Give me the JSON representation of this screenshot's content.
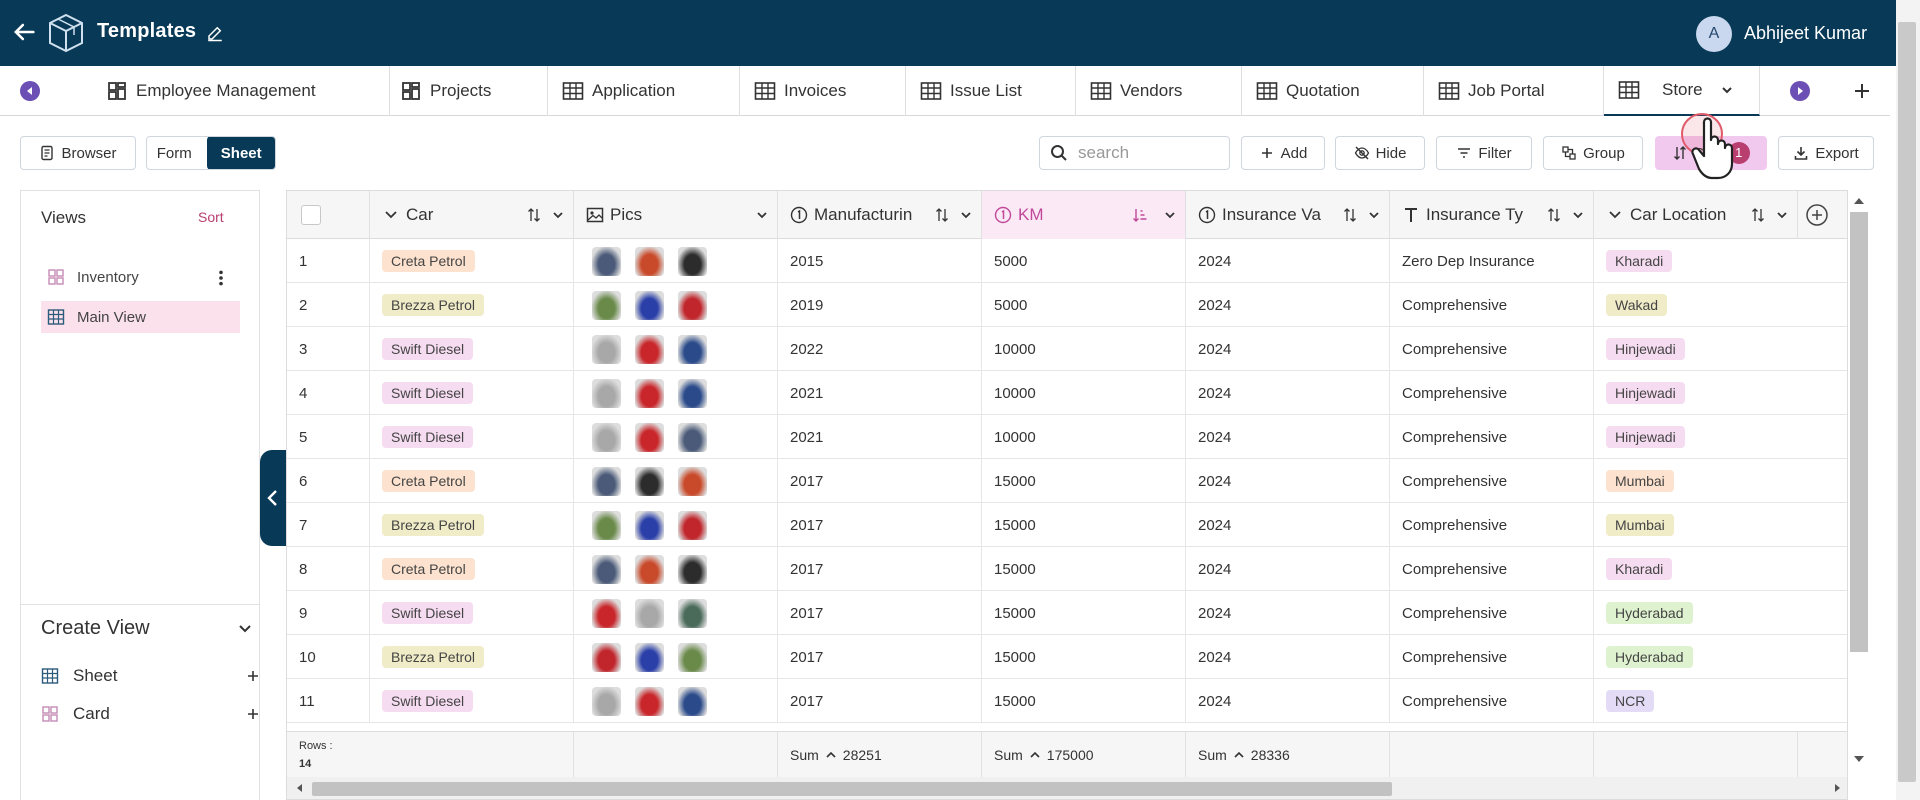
{
  "topbar": {
    "title": "Templates",
    "user_initial": "A",
    "user_name": "Abhijeet Kumar"
  },
  "tabs": [
    {
      "label": "Employee Management",
      "icon": "dashboard-icon"
    },
    {
      "label": "Projects",
      "icon": "dashboard-icon"
    },
    {
      "label": "Application",
      "icon": "table-icon"
    },
    {
      "label": "Invoices",
      "icon": "table-icon"
    },
    {
      "label": "Issue List",
      "icon": "table-icon"
    },
    {
      "label": "Vendors",
      "icon": "table-icon"
    },
    {
      "label": "Quotation",
      "icon": "table-icon"
    },
    {
      "label": "Job Portal",
      "icon": "table-icon"
    },
    {
      "label": "Store",
      "icon": "table-icon",
      "active": true
    }
  ],
  "toolbar": {
    "browser": "Browser",
    "form": "Form",
    "sheet": "Sheet",
    "search_placeholder": "search",
    "add": "Add",
    "hide": "Hide",
    "filter": "Filter",
    "group": "Group",
    "sort": "Sort",
    "sort_count": "1",
    "export": "Export"
  },
  "views_panel": {
    "title": "Views",
    "sort": "Sort",
    "items": [
      {
        "label": "Inventory",
        "icon": "card-icon"
      },
      {
        "label": "Main View",
        "icon": "table-icon",
        "selected": true
      }
    ],
    "create_title": "Create View",
    "create_items": [
      {
        "label": "Sheet",
        "icon": "table-icon"
      },
      {
        "label": "Card",
        "icon": "card-icon"
      }
    ]
  },
  "columns": [
    {
      "label": "Car",
      "icon": "chevron-down-icon"
    },
    {
      "label": "Pics",
      "icon": "image-icon"
    },
    {
      "label": "Manufacturin",
      "icon": "number-icon"
    },
    {
      "label": "KM",
      "icon": "number-icon",
      "sorted": true
    },
    {
      "label": "Insurance Va",
      "icon": "number-icon"
    },
    {
      "label": "Insurance Ty",
      "icon": "text-icon"
    },
    {
      "label": "Car Location",
      "icon": "chevron-down-icon"
    }
  ],
  "rows": [
    {
      "n": "1",
      "car": "Creta Petrol",
      "car_color": "creta",
      "pics": [
        "#4a5a78",
        "#c94a2a",
        "#2c2c2c"
      ],
      "mfg": "2015",
      "km": "5000",
      "ins_val": "2024",
      "ins_type": "Zero Dep Insurance",
      "loc": "Kharadi",
      "loc_color": "pink"
    },
    {
      "n": "2",
      "car": "Brezza Petrol",
      "car_color": "brezza",
      "pics": [
        "#6a8a4a",
        "#2a3fa8",
        "#c0262c"
      ],
      "mfg": "2019",
      "km": "5000",
      "ins_val": "2024",
      "ins_type": "Comprehensive",
      "loc": "Wakad",
      "loc_color": "tan"
    },
    {
      "n": "3",
      "car": "Swift Diesel",
      "car_color": "swift",
      "pics": [
        "#a8a8a8",
        "#c8262a",
        "#2a4a8a"
      ],
      "mfg": "2022",
      "km": "10000",
      "ins_val": "2024",
      "ins_type": "Comprehensive",
      "loc": "Hinjewadi",
      "loc_color": "pink"
    },
    {
      "n": "4",
      "car": "Swift Diesel",
      "car_color": "swift",
      "pics": [
        "#a8a8a8",
        "#c8262a",
        "#2a4a8a"
      ],
      "mfg": "2021",
      "km": "10000",
      "ins_val": "2024",
      "ins_type": "Comprehensive",
      "loc": "Hinjewadi",
      "loc_color": "pink"
    },
    {
      "n": "5",
      "car": "Swift Diesel",
      "car_color": "swift",
      "pics": [
        "#a8a8a8",
        "#c8262a",
        "#4a5a78"
      ],
      "mfg": "2021",
      "km": "10000",
      "ins_val": "2024",
      "ins_type": "Comprehensive",
      "loc": "Hinjewadi",
      "loc_color": "pink"
    },
    {
      "n": "6",
      "car": "Creta Petrol",
      "car_color": "creta",
      "pics": [
        "#4a5a78",
        "#2c2c2c",
        "#c94a2a"
      ],
      "mfg": "2017",
      "km": "15000",
      "ins_val": "2024",
      "ins_type": "Comprehensive",
      "loc": "Mumbai",
      "loc_color": "peach"
    },
    {
      "n": "7",
      "car": "Brezza Petrol",
      "car_color": "brezza",
      "pics": [
        "#6a8a4a",
        "#2a3fa8",
        "#c0262c"
      ],
      "mfg": "2017",
      "km": "15000",
      "ins_val": "2024",
      "ins_type": "Comprehensive",
      "loc": "Mumbai",
      "loc_color": "tan"
    },
    {
      "n": "8",
      "car": "Creta Petrol",
      "car_color": "creta",
      "pics": [
        "#4a5a78",
        "#c94a2a",
        "#2c2c2c"
      ],
      "mfg": "2017",
      "km": "15000",
      "ins_val": "2024",
      "ins_type": "Comprehensive",
      "loc": "Kharadi",
      "loc_color": "pink"
    },
    {
      "n": "9",
      "car": "Swift Diesel",
      "car_color": "swift",
      "pics": [
        "#c8262a",
        "#a8a8a8",
        "#4a6a5a"
      ],
      "mfg": "2017",
      "km": "15000",
      "ins_val": "2024",
      "ins_type": "Comprehensive",
      "loc": "Hyderabad",
      "loc_color": "green"
    },
    {
      "n": "10",
      "car": "Brezza Petrol",
      "car_color": "brezza",
      "pics": [
        "#c0262c",
        "#2a3fa8",
        "#6a8a4a"
      ],
      "mfg": "2017",
      "km": "15000",
      "ins_val": "2024",
      "ins_type": "Comprehensive",
      "loc": "Hyderabad",
      "loc_color": "green"
    },
    {
      "n": "11",
      "car": "Swift Diesel",
      "car_color": "swift",
      "pics": [
        "#a8a8a8",
        "#c8262a",
        "#2a4a8a"
      ],
      "mfg": "2017",
      "km": "15000",
      "ins_val": "2024",
      "ins_type": "Comprehensive",
      "loc": "NCR",
      "loc_color": "lav"
    }
  ],
  "footer": {
    "rows_label": "Rows :",
    "rows_count": "14",
    "sum_label": "Sum",
    "mfg_sum": "28251",
    "km_sum": "175000",
    "ins_val_sum": "28336"
  },
  "colors": {
    "brand": "#083a57",
    "accent": "#b83f70",
    "sort_bg": "#f1c9ef"
  }
}
